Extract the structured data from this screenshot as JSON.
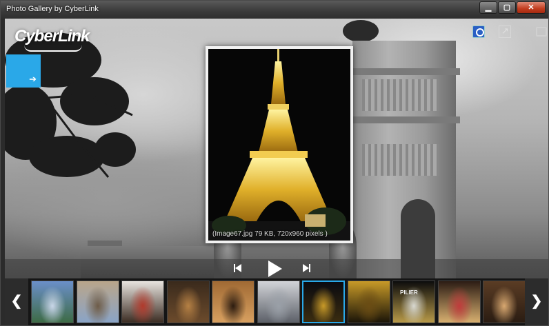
{
  "window": {
    "title": "Photo Gallery by CyberLink",
    "controls": [
      "minimize",
      "maximize",
      "close"
    ]
  },
  "branding": {
    "logo": "CyberLink"
  },
  "toolbar": {
    "icons": [
      "facebook-icon",
      "share-icon",
      "fullscreen-icon"
    ]
  },
  "viewer": {
    "caption": "(Image67.jpg 79 KB, 720x960 pixels )"
  },
  "playback": {
    "icons": [
      "previous-icon",
      "play-icon",
      "next-icon"
    ]
  },
  "filmstrip": {
    "selected_index": 6,
    "thumbnails": [
      {
        "subject": "column monument",
        "colors": [
          "#6b8fc9",
          "#c9d6e8",
          "#3d6b45"
        ]
      },
      {
        "subject": "wall with sign",
        "colors": [
          "#b9a58a",
          "#6e5c48",
          "#8aa4c6"
        ]
      },
      {
        "subject": "red storefront",
        "colors": [
          "#e8e4df",
          "#b23a2c",
          "#3b2c22"
        ]
      },
      {
        "subject": "restaurant interior",
        "colors": [
          "#3a2a1c",
          "#b58044",
          "#6c4b2c"
        ]
      },
      {
        "subject": "dining room",
        "colors": [
          "#a06a34",
          "#2c1c10",
          "#d8a060"
        ]
      },
      {
        "subject": "stone monument",
        "colors": [
          "#d2d4d8",
          "#9aa0a8",
          "#5c6068"
        ]
      },
      {
        "subject": "eiffel tower night",
        "colors": [
          "#0a0a10",
          "#c89a28",
          "#3a2c10"
        ]
      },
      {
        "subject": "eiffel tower detail",
        "colors": [
          "#c89a28",
          "#6a4c14",
          "#1a1408"
        ]
      },
      {
        "subject": "pilier sign",
        "colors": [
          "#0c0c0c",
          "#d8d8d0",
          "#b89a48"
        ],
        "label": "PILIER"
      },
      {
        "subject": "evening street",
        "colors": [
          "#2c1c14",
          "#c03c3c",
          "#d8b070"
        ]
      },
      {
        "subject": "cafe interior",
        "colors": [
          "#5a3c24",
          "#d8a870",
          "#2a1c12"
        ]
      }
    ]
  }
}
